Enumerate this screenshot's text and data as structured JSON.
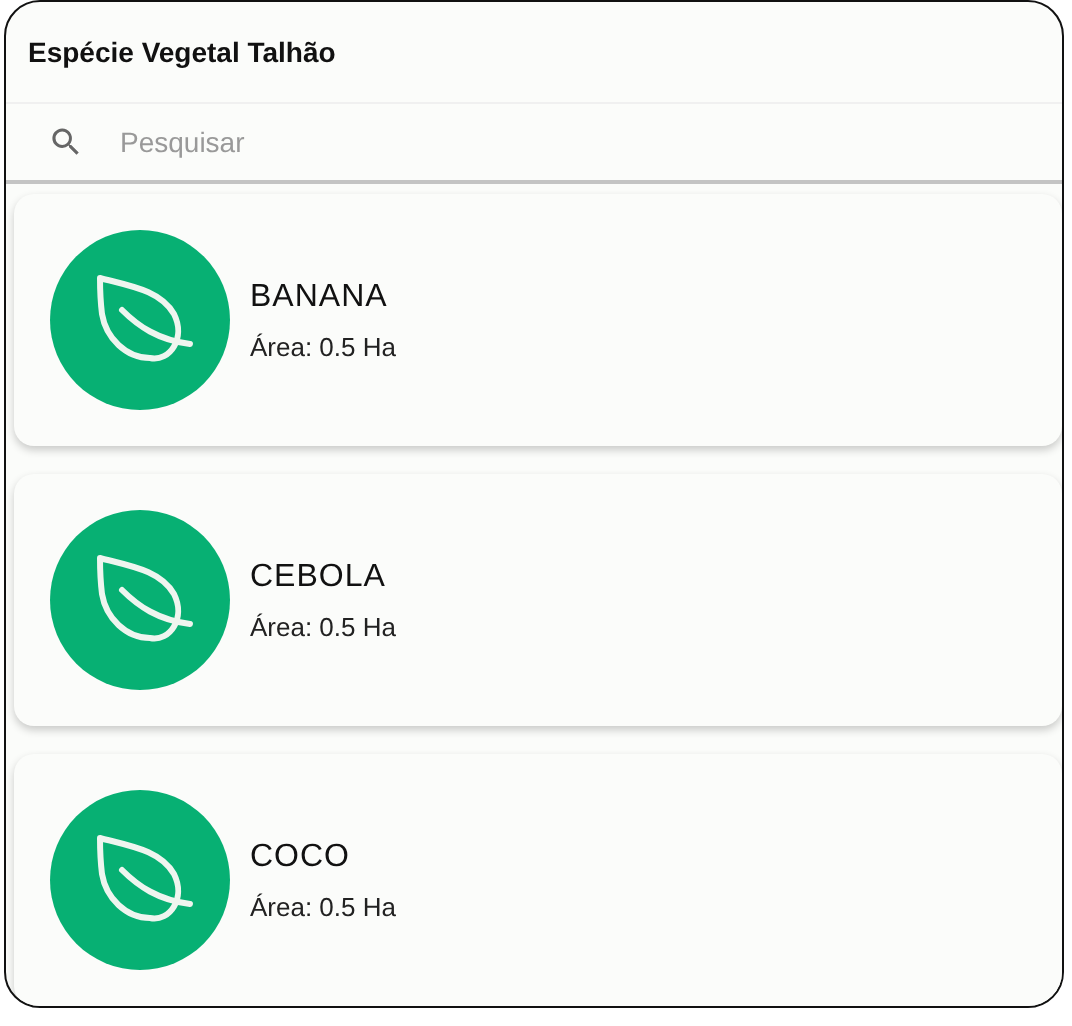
{
  "header": {
    "title": "Espécie Vegetal Talhão"
  },
  "search": {
    "placeholder": "Pesquisar"
  },
  "items": [
    {
      "name": "BANANA",
      "area": "Área: 0.5 Ha"
    },
    {
      "name": "CEBOLA",
      "area": "Área: 0.5 Ha"
    },
    {
      "name": "COCO",
      "area": "Área: 0.5 Ha"
    }
  ]
}
